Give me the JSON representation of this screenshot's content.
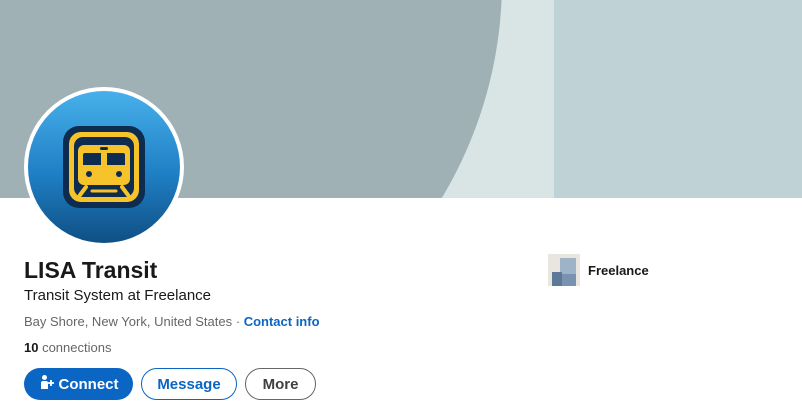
{
  "profile": {
    "name": "LISA Transit",
    "headline": "Transit System at Freelance",
    "location": "Bay Shore, New York, United States",
    "separator": " · ",
    "contact_info_label": "Contact info",
    "connections_count": "10",
    "connections_label": " connections"
  },
  "actions": {
    "connect_label": "Connect",
    "message_label": "Message",
    "more_label": "More"
  },
  "experience": {
    "company_name": "Freelance"
  },
  "icons": {
    "avatar": "train-front-icon",
    "connect": "add-person-icon",
    "company": "company-logo-icon"
  },
  "colors": {
    "accent": "#0a66c2",
    "text_primary": "#191919",
    "text_secondary": "#666666",
    "banner_dark": "#9fb1b5",
    "banner_light": "#d9e4e5",
    "avatar_bg": "#2a8fd6",
    "train_yellow": "#f6c42a"
  }
}
